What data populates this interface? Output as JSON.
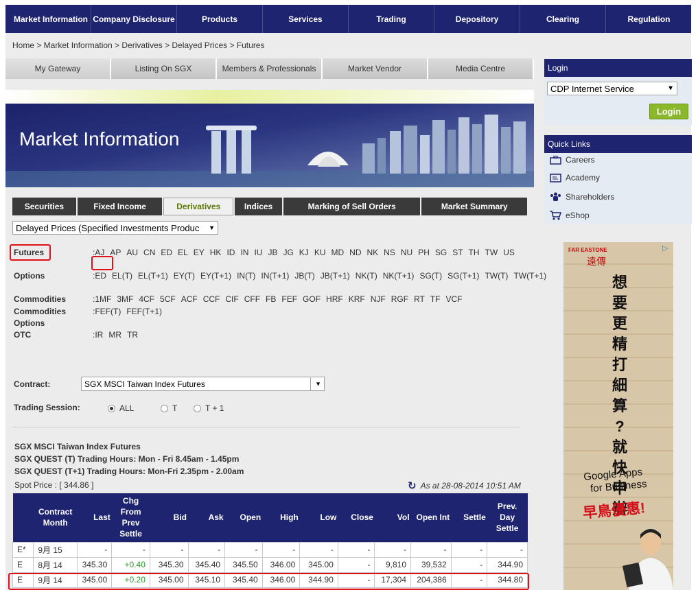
{
  "topnav": [
    "Market Information",
    "Company Disclosure",
    "Products",
    "Services",
    "Trading",
    "Depository",
    "Clearing",
    "Regulation"
  ],
  "breadcrumb": "Home > Market Information > Derivatives > Delayed Prices > Futures",
  "subtabs": [
    "My Gateway",
    "Listing On SGX",
    "Members & Professionals",
    "Market Vendor",
    "Media Centre"
  ],
  "banner_title": "Market Information",
  "dtabs": [
    "Securities",
    "Fixed Income",
    "Derivatives",
    "Indices",
    "Marking of Sell Orders",
    "Market Summary"
  ],
  "dtabs_active": "Derivatives",
  "page_select": "Delayed Prices (Specified Investments Produc",
  "codes": {
    "futures": {
      "label": "Futures",
      "values": [
        "AJ",
        "AP",
        "AU",
        "CN",
        "ED",
        "EL",
        "EY",
        "HK",
        "ID",
        "IN",
        "IU",
        "JB",
        "JG",
        "KJ",
        "KU",
        "MD",
        "ND",
        "NK",
        "NS",
        "NU",
        "PH",
        "SG",
        "ST",
        "TH",
        "TW",
        "US"
      ]
    },
    "options": {
      "label": "Options",
      "values": [
        "ED",
        "EL(T)",
        "EL(T+1)",
        "EY(T)",
        "EY(T+1)",
        "IN(T)",
        "IN(T+1)",
        "JB(T)",
        "JB(T+1)",
        "NK(T)",
        "NK(T+1)",
        "SG(T)",
        "SG(T+1)",
        "TW(T)",
        "TW(T+1)"
      ]
    },
    "commodities": {
      "label": "Commodities",
      "values": [
        "1MF",
        "3MF",
        "4CF",
        "5CF",
        "ACF",
        "CCF",
        "CIF",
        "CFF",
        "FB",
        "FEF",
        "GOF",
        "HRF",
        "KRF",
        "NJF",
        "RGF",
        "RT",
        "TF",
        "VCF"
      ]
    },
    "commodities_options": {
      "label1": "Commodities",
      "label2": "Options",
      "values": [
        "FEF(T)",
        "FEF(T+1)"
      ]
    },
    "otc": {
      "label": "OTC",
      "values": [
        "IR",
        "MR",
        "TR"
      ]
    }
  },
  "contract": {
    "label": "Contract:",
    "value": "SGX MSCI Taiwan Index Futures"
  },
  "session": {
    "label": "Trading Session:",
    "options": [
      "ALL",
      "T",
      "T + 1"
    ],
    "selected": "ALL"
  },
  "info": {
    "name": "SGX MSCI Taiwan Index Futures",
    "hours_t": "SGX QUEST (T) Trading Hours: Mon - Fri 8.45am - 1.45pm",
    "hours_t1": "SGX QUEST (T+1) Trading Hours: Mon-Fri 2.35pm - 2.00am",
    "spot": "Spot Price : [ 344.86 ]",
    "asof": "As at 28-08-2014 10:51 AM"
  },
  "table": {
    "headers": [
      [
        "",
        ""
      ],
      [
        "Contract",
        "Month"
      ],
      [
        "Last"
      ],
      [
        "Chg",
        "From",
        "Prev",
        "Settle"
      ],
      [
        "Bid"
      ],
      [
        "Ask"
      ],
      [
        "Open"
      ],
      [
        "High"
      ],
      [
        "Low"
      ],
      [
        "Close"
      ],
      [
        "Vol"
      ],
      [
        "Open Int"
      ],
      [
        "Settle"
      ],
      [
        "Prev.",
        "Day",
        "Settle"
      ]
    ],
    "rows": [
      [
        "E*",
        "9月 15",
        "-",
        "-",
        "-",
        "-",
        "-",
        "-",
        "-",
        "-",
        "-",
        "-",
        "-",
        "-"
      ],
      [
        "E",
        "8月 14",
        "345.30",
        "+0.40",
        "345.30",
        "345.40",
        "345.50",
        "346.00",
        "345.00",
        "-",
        "9,810",
        "39,532",
        "-",
        "344.90"
      ],
      [
        "E",
        "9月 14",
        "345.00",
        "+0.20",
        "345.00",
        "345.10",
        "345.40",
        "346.00",
        "344.90",
        "-",
        "17,304",
        "204,386",
        "-",
        "344.80"
      ]
    ]
  },
  "sidebar": {
    "login_title": "Login",
    "login_select": "CDP Internet Service",
    "login_button": "Login",
    "quicklinks_title": "Quick Links",
    "quicklinks": [
      "Careers",
      "Academy",
      "Shareholders",
      "eShop"
    ]
  },
  "ad": {
    "brand": "FAR EASTONE",
    "brand_cn": "遠傳",
    "vertical": [
      "想",
      "要",
      "更",
      "精",
      "打",
      "細",
      "算",
      "?",
      "就",
      "快",
      "申",
      "辦"
    ],
    "gapps1": "Google Apps",
    "gapps2": "for Business",
    "promo": "早鳥優惠!"
  }
}
